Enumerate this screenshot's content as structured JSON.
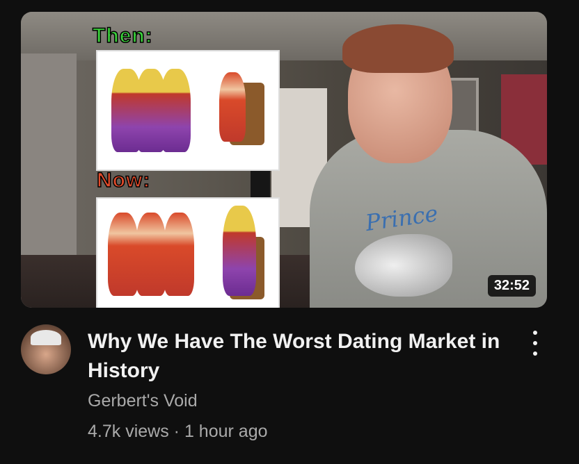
{
  "video": {
    "thumbnail": {
      "label_then": "Then:",
      "label_now": "Now:",
      "hoodie_text": "Prince",
      "duration": "32:52"
    },
    "title_line1": "Why We Have The Worst Dating Market in",
    "title_line2": "History",
    "channel": "Gerbert's Void",
    "views": "4.7k views",
    "separator": "·",
    "uploaded": "1 hour ago"
  },
  "icons": {
    "more": "more-vert-icon"
  }
}
